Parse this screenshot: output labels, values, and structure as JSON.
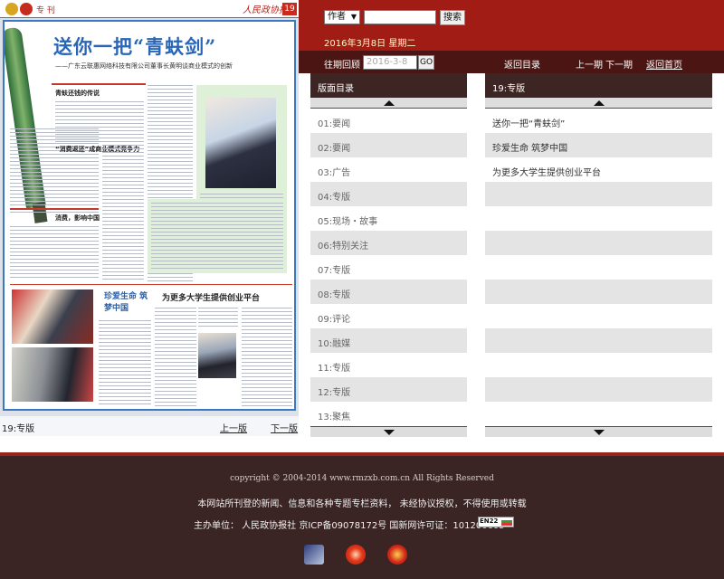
{
  "paper": {
    "section": "专 刊",
    "masthead": "人民政协报",
    "page_no": "19",
    "headline": "送你一把“青蚨剑”",
    "subhead": "——广东云联惠网络科技有限公司董事长黄明谈商业模式的创新",
    "kicker1": "青蚨还钱的传说",
    "kicker2": "“消费返还”成商业模式竞争力",
    "kicker3": "消费，影响中国",
    "story2_title": "珍爱生命 筑梦中国",
    "story3_title": "为更多大学生提供创业平台",
    "current_page": "19:专版",
    "prev_label": "上一版",
    "next_label": "下一版"
  },
  "search": {
    "select_value": "作者",
    "input_value": "",
    "button_label": "搜索"
  },
  "date_text": "2016年3月8日 星期二",
  "nav": {
    "history_label": "往期回顾",
    "date_placeholder": "2016-3-8",
    "go_label": "GO",
    "back_catalog": "返回目录",
    "prev_issue": "上一期",
    "next_issue": "下一期",
    "home": "返回首页"
  },
  "left_panel": {
    "title": "版面目录",
    "items": [
      "01:要闻",
      "02:要闻",
      "03:广告",
      "04:专版",
      "05:现场・故事",
      "06:特别关注",
      "07:专版",
      "08:专版",
      "09:评论",
      "10:融媒",
      "11:专版",
      "12:专版",
      "13:聚焦"
    ]
  },
  "right_panel": {
    "title": "19:专版",
    "items": [
      "送你一把“青蚨剑”",
      "珍爱生命 筑梦中国",
      "为更多大学生提供创业平台",
      "",
      "",
      "",
      "",
      "",
      "",
      "",
      "",
      "",
      ""
    ]
  },
  "footer": {
    "copyright": "copyright © 2004-2014 www.rmzxb.com.cn All Rights Reserved",
    "notice": "本网站所刊登的新闻、信息和各种专题专栏资料， 未经协议授权，不得使用或转载",
    "sponsor": "主办单位： 人民政协报社 京ICP备09078172号 国新网许可证：101200605",
    "badge": "EN22"
  },
  "colors": {
    "topbar": "#a11c14",
    "navbar": "#4a1512",
    "panel_head": "#3d2523",
    "footer": "#3b2524",
    "headline_blue": "#2a66b8"
  }
}
